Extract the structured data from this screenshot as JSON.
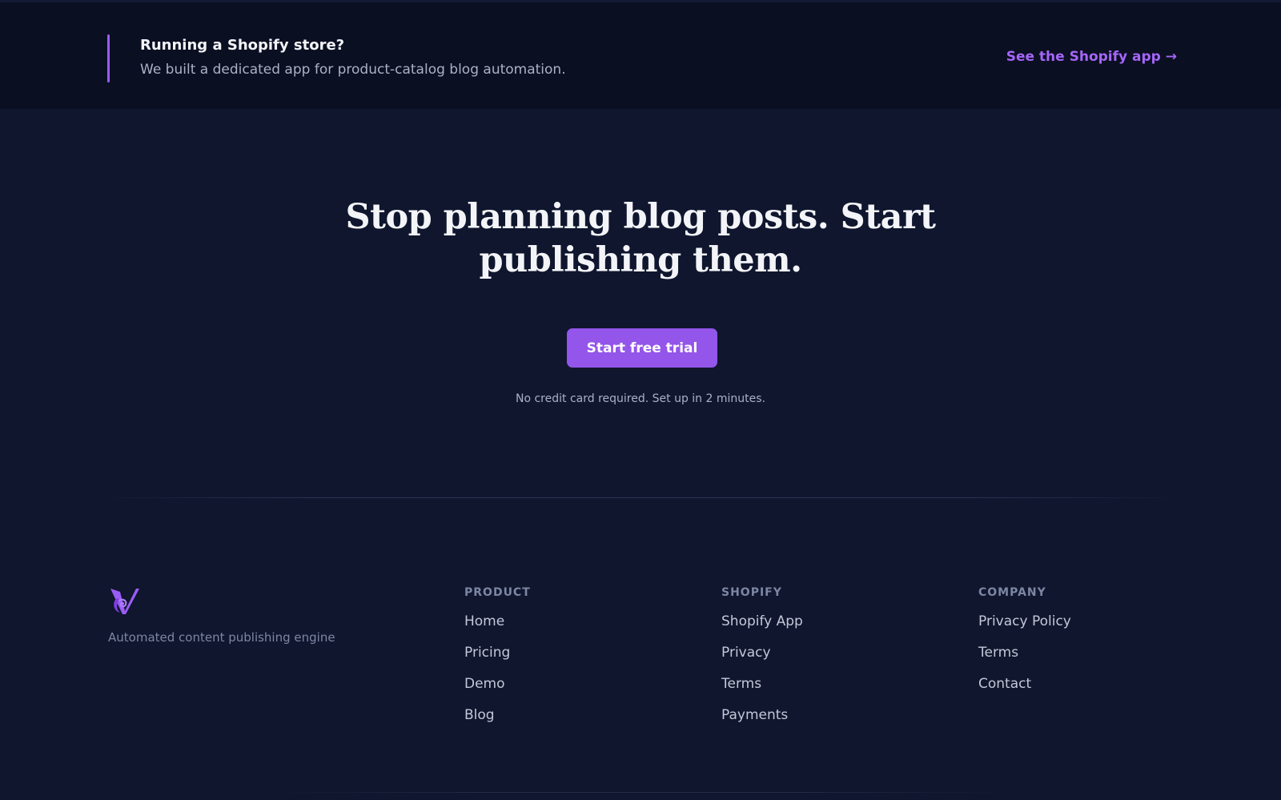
{
  "banner": {
    "title": "Running a Shopify store?",
    "subtitle": "We built a dedicated app for product-catalog blog automation.",
    "link_label": "See the Shopify app →"
  },
  "hero": {
    "title": "Stop planning blog posts. Start publishing them.",
    "cta_label": "Start free trial",
    "note": "No credit card required. Set up in 2 minutes."
  },
  "footer": {
    "tagline": "Automated content publishing engine",
    "columns": [
      {
        "heading": "PRODUCT",
        "links": [
          "Home",
          "Pricing",
          "Demo",
          "Blog"
        ]
      },
      {
        "heading": "SHOPIFY",
        "links": [
          "Shopify App",
          "Privacy",
          "Terms",
          "Payments"
        ]
      },
      {
        "heading": "COMPANY",
        "links": [
          "Privacy Policy",
          "Terms",
          "Contact"
        ]
      }
    ]
  },
  "colors": {
    "background": "#0f162e",
    "banner_background": "#0a0f22",
    "accent": "#9b5cf6",
    "button": "#9355ea"
  },
  "icons": {
    "logo": "brand-logo-icon"
  }
}
